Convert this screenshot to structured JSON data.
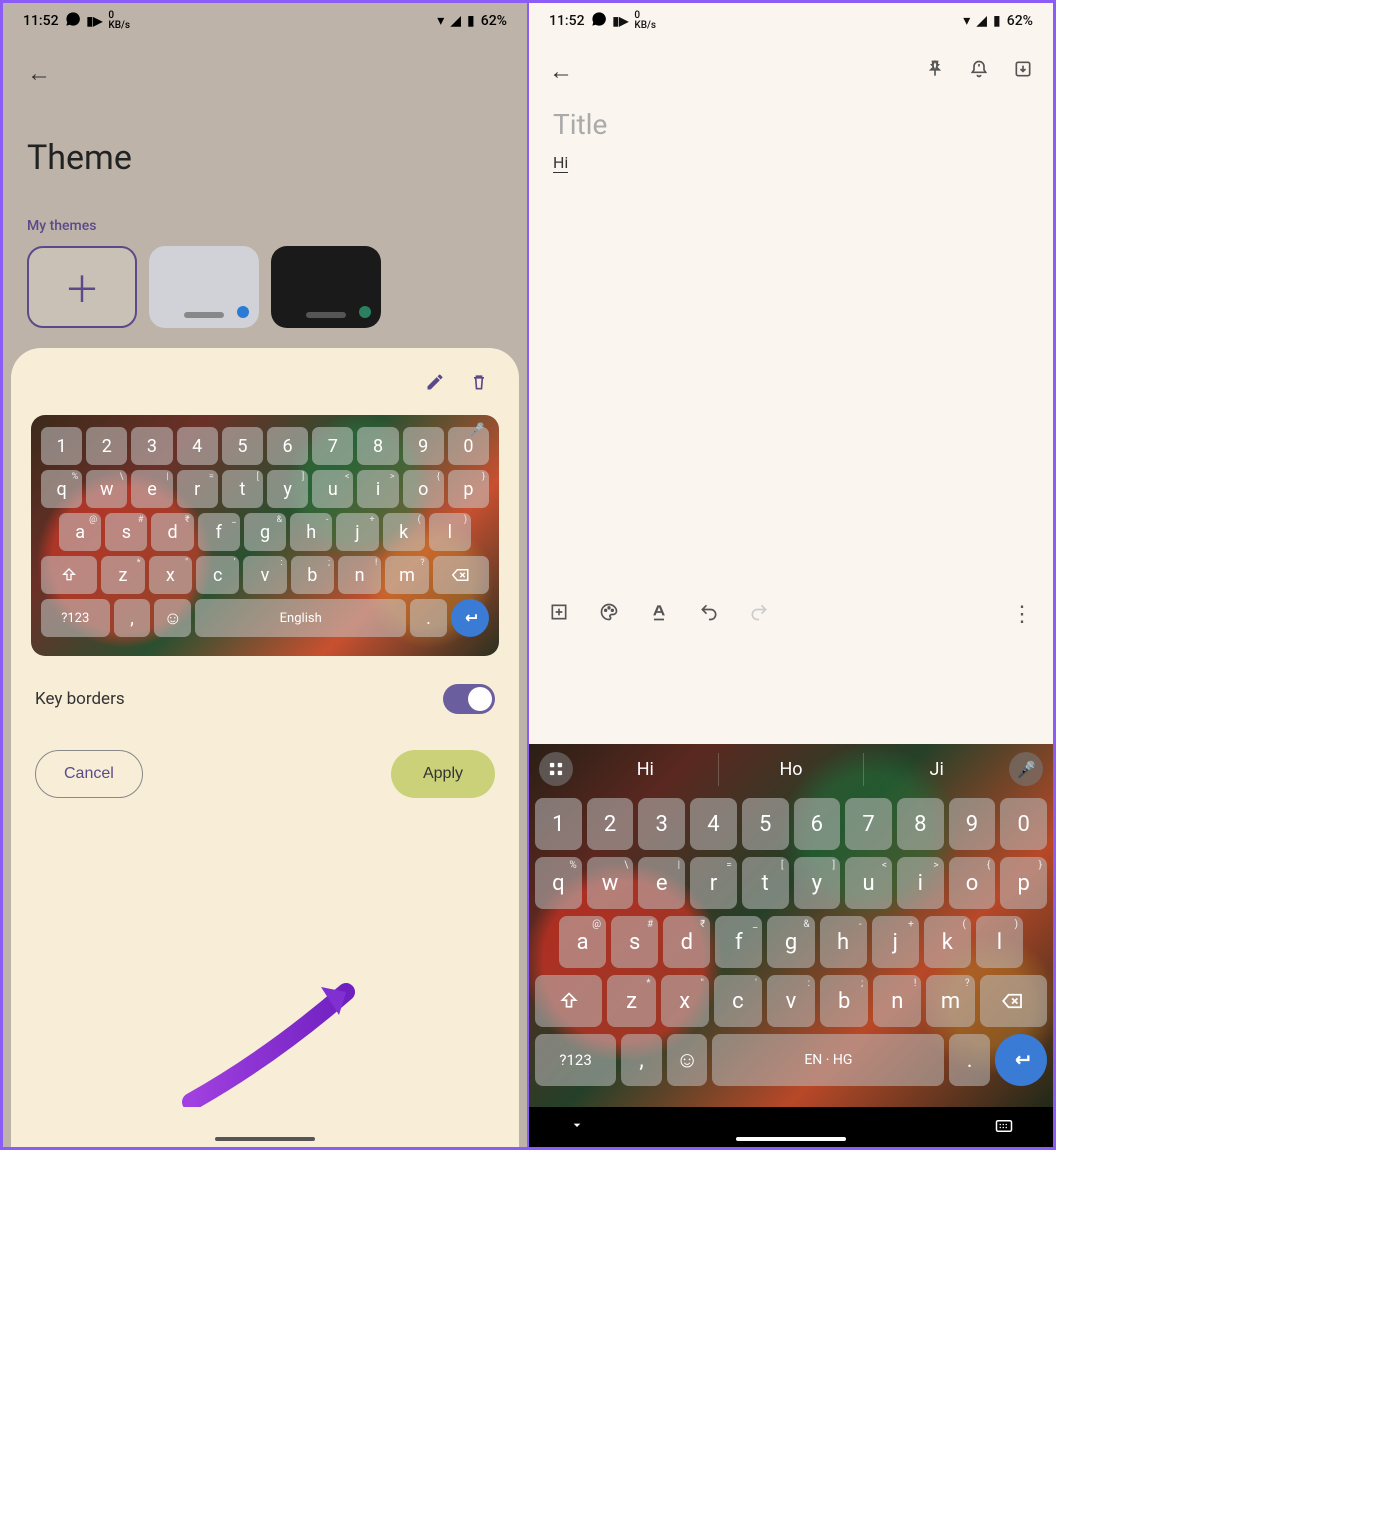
{
  "status": {
    "time": "11:52",
    "data_rate": "0",
    "data_unit": "KB/s",
    "battery_pct": "62%"
  },
  "left": {
    "page_title": "Theme",
    "my_themes_label": "My themes",
    "sheet": {
      "key_borders_label": "Key borders",
      "key_borders_on": true,
      "cancel": "Cancel",
      "apply": "Apply",
      "preview_keyboard": {
        "row_num": [
          "1",
          "2",
          "3",
          "4",
          "5",
          "6",
          "7",
          "8",
          "9",
          "0"
        ],
        "row_q": [
          {
            "k": "q",
            "s": "%"
          },
          {
            "k": "w",
            "s": "\\"
          },
          {
            "k": "e",
            "s": "|"
          },
          {
            "k": "r",
            "s": "="
          },
          {
            "k": "t",
            "s": "["
          },
          {
            "k": "y",
            "s": "]"
          },
          {
            "k": "u",
            "s": "<"
          },
          {
            "k": "i",
            "s": ">"
          },
          {
            "k": "o",
            "s": "{"
          },
          {
            "k": "p",
            "s": "}"
          }
        ],
        "row_a": [
          {
            "k": "a",
            "s": "@"
          },
          {
            "k": "s",
            "s": "#"
          },
          {
            "k": "d",
            "s": "₹"
          },
          {
            "k": "f",
            "s": "_"
          },
          {
            "k": "g",
            "s": "&"
          },
          {
            "k": "h",
            "s": "-"
          },
          {
            "k": "j",
            "s": "+"
          },
          {
            "k": "k",
            "s": "("
          },
          {
            "k": "l",
            "s": ")"
          }
        ],
        "row_z": [
          {
            "k": "z",
            "s": "*"
          },
          {
            "k": "x",
            "s": "\""
          },
          {
            "k": "c",
            "s": "'"
          },
          {
            "k": "v",
            "s": ":"
          },
          {
            "k": "b",
            "s": ";"
          },
          {
            "k": "n",
            "s": "!"
          },
          {
            "k": "m",
            "s": "?"
          }
        ],
        "sym": "?123",
        "space": "English"
      }
    }
  },
  "right": {
    "title_placeholder": "Title",
    "note_text": "Hi",
    "suggestions": [
      "Hi",
      "Ho",
      "Ji"
    ],
    "keyboard": {
      "row_num": [
        "1",
        "2",
        "3",
        "4",
        "5",
        "6",
        "7",
        "8",
        "9",
        "0"
      ],
      "row_q": [
        {
          "k": "q",
          "s": "%"
        },
        {
          "k": "w",
          "s": "\\"
        },
        {
          "k": "e",
          "s": "|"
        },
        {
          "k": "r",
          "s": "="
        },
        {
          "k": "t",
          "s": "["
        },
        {
          "k": "y",
          "s": "]"
        },
        {
          "k": "u",
          "s": "<"
        },
        {
          "k": "i",
          "s": ">"
        },
        {
          "k": "o",
          "s": "{"
        },
        {
          "k": "p",
          "s": "}"
        }
      ],
      "row_a": [
        {
          "k": "a",
          "s": "@"
        },
        {
          "k": "s",
          "s": "#"
        },
        {
          "k": "d",
          "s": "₹"
        },
        {
          "k": "f",
          "s": "_"
        },
        {
          "k": "g",
          "s": "&"
        },
        {
          "k": "h",
          "s": "-"
        },
        {
          "k": "j",
          "s": "+"
        },
        {
          "k": "k",
          "s": "("
        },
        {
          "k": "l",
          "s": ")"
        }
      ],
      "row_z": [
        {
          "k": "z",
          "s": "*"
        },
        {
          "k": "x",
          "s": "\""
        },
        {
          "k": "c",
          "s": "'"
        },
        {
          "k": "v",
          "s": ":"
        },
        {
          "k": "b",
          "s": ";"
        },
        {
          "k": "n",
          "s": "!"
        },
        {
          "k": "m",
          "s": "?"
        }
      ],
      "sym": "?123",
      "space": "EN · HG"
    }
  }
}
